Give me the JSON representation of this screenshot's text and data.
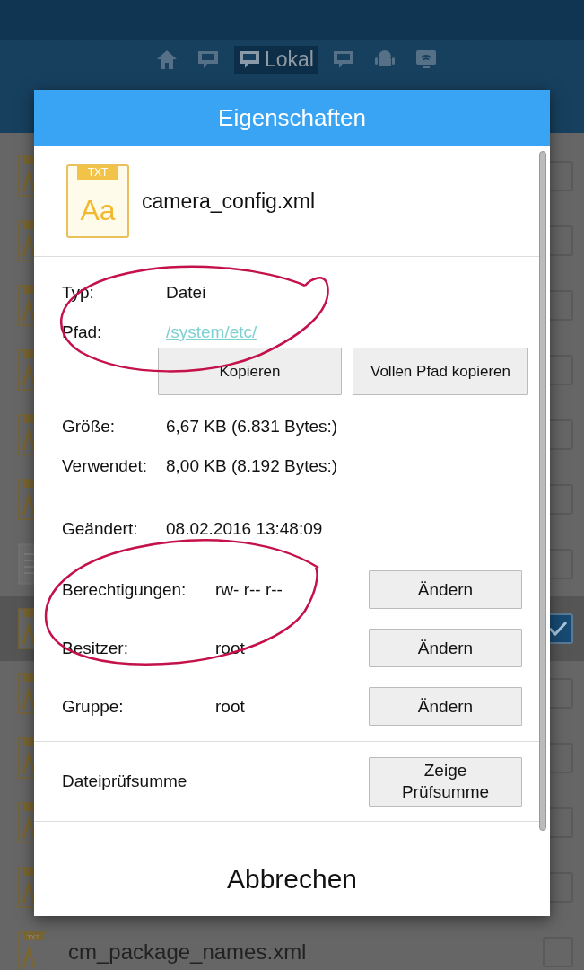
{
  "storage_tabs": [
    {
      "kind": "home",
      "selected": false
    },
    {
      "kind": "sd",
      "selected": false
    },
    {
      "kind": "sd",
      "label": "Lokal",
      "selected": true
    },
    {
      "kind": "sd",
      "selected": false
    },
    {
      "kind": "android",
      "selected": false
    },
    {
      "kind": "cast",
      "selected": false
    }
  ],
  "files": [
    {
      "kind": "txt",
      "checked": false
    },
    {
      "kind": "txt",
      "checked": false
    },
    {
      "kind": "txt",
      "checked": false
    },
    {
      "kind": "txt",
      "checked": false
    },
    {
      "kind": "txt",
      "checked": false
    },
    {
      "kind": "txt",
      "checked": false
    },
    {
      "kind": "doc",
      "checked": false
    },
    {
      "kind": "txt",
      "checked": true
    },
    {
      "kind": "txt",
      "checked": false
    },
    {
      "kind": "txt",
      "checked": false
    },
    {
      "kind": "txt",
      "checked": false
    },
    {
      "kind": "txt",
      "checked": false
    },
    {
      "kind": "txt",
      "icon_label": "TXT",
      "name": "cm_package_names.xml",
      "checked": false
    }
  ],
  "dialog": {
    "title": "Eigenschaften",
    "file_icon": {
      "label": "TXT",
      "glyph": "Aa"
    },
    "file_name": "camera_config.xml",
    "location": [
      {
        "label": "Typ:",
        "value": "Datei",
        "kind": "text"
      },
      {
        "label": "Pfad:",
        "value": "/system/etc/",
        "kind": "link"
      }
    ],
    "path_buttons": [
      "Kopieren",
      "Vollen Pfad kopieren"
    ],
    "size": [
      {
        "label": "Größe:",
        "value": "6,67 KB (6.831 Bytes:)"
      },
      {
        "label": "Verwendet:",
        "value": "8,00 KB (8.192 Bytes:)"
      }
    ],
    "modified": {
      "label": "Geändert:",
      "value": "08.02.2016 13:48:09"
    },
    "permissions": [
      {
        "label": "Berechtigungen:",
        "value": "rw- r-- r--",
        "button": "Ändern"
      },
      {
        "label": "Besitzer:",
        "value": "root",
        "button": "Ändern"
      },
      {
        "label": "Gruppe:",
        "value": "root",
        "button": "Ändern"
      }
    ],
    "checksum": {
      "label": "Dateiprüfsumme",
      "button": "Zeige Prüfsumme"
    },
    "cancel": "Abbrechen"
  }
}
